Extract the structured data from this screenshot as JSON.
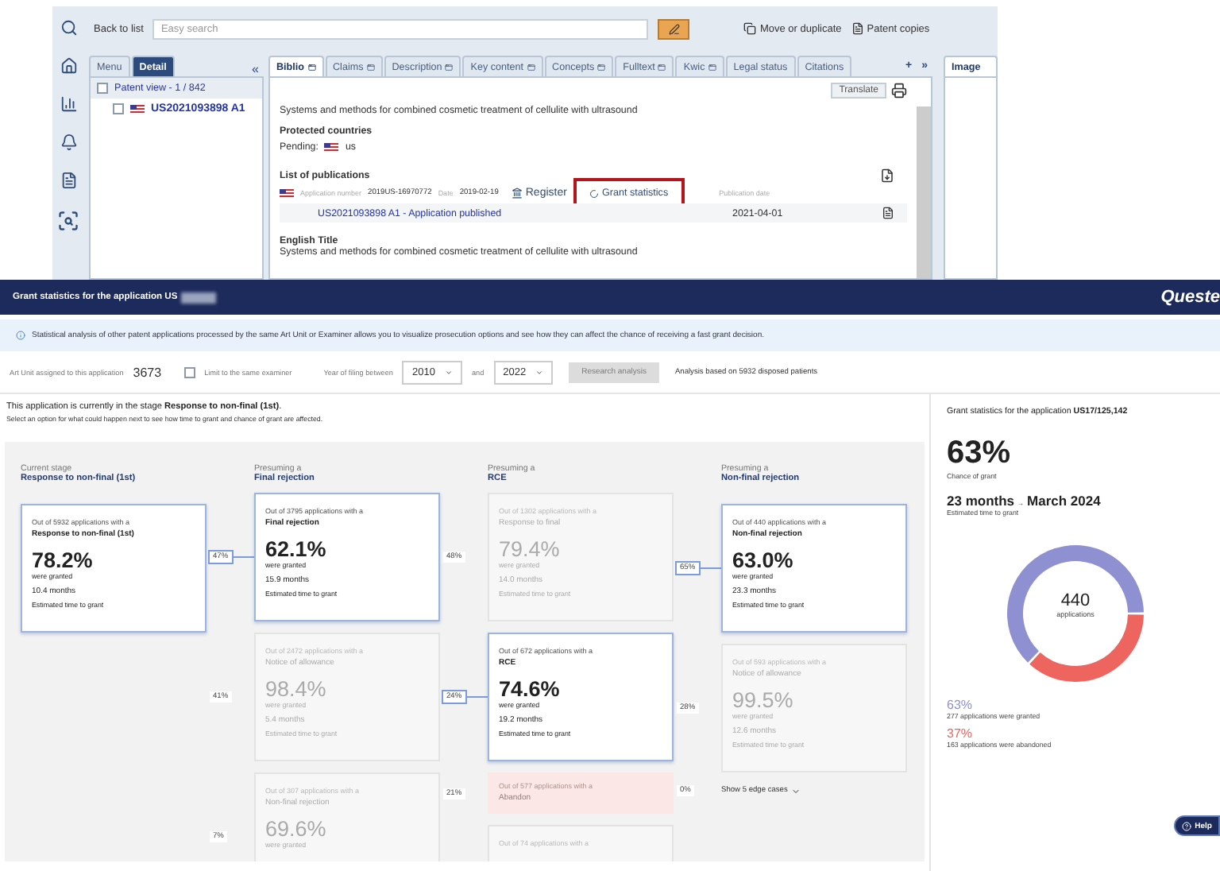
{
  "app": {
    "toolbar": {
      "back": "Back to list",
      "search_placeholder": "Easy search",
      "actions": [
        "Move or duplicate",
        "Patent copies"
      ]
    },
    "left_panel": {
      "tabs": [
        {
          "label": "Menu",
          "selected": false
        },
        {
          "label": "Detail",
          "selected": true
        }
      ],
      "collapse": "«",
      "tree": [
        {
          "label": "Patent view - 1 / 842",
          "checked": false,
          "children": [
            {
              "label": "US2021093898 A1",
              "checked": false
            }
          ]
        }
      ]
    },
    "tabs": [
      {
        "label": "Biblio",
        "selected": true
      },
      {
        "label": "Claims",
        "selected": false
      },
      {
        "label": "Description",
        "selected": false
      },
      {
        "label": "Key content",
        "selected": false
      },
      {
        "label": "Concepts",
        "selected": false
      },
      {
        "label": "Fulltext",
        "selected": false
      },
      {
        "label": "Kwic",
        "selected": false
      },
      {
        "label": "Legal status",
        "selected": false
      },
      {
        "label": "Citations",
        "selected": false
      }
    ],
    "tab_controls": [
      "+",
      "»"
    ],
    "image_tab": "Image",
    "content": {
      "translate": "Translate",
      "title": "Systems and methods for combined cosmetic treatment of cellulite with ultrasound",
      "protected_heading": "Protected countries",
      "pending_label": "Pending:",
      "pending_country": "us",
      "publications_heading": "List of publications",
      "application_label": "Application number",
      "application_number": "2019US-16970772",
      "date_label": "Date",
      "date": "2019-02-19",
      "register": "Register",
      "grant_statistics": {
        "label": "Grant statistics",
        "highlighted": true
      },
      "publication_date_label": "Publication date",
      "publication": "US2021093898  A1 - Application published",
      "publication_date": "2021-04-01",
      "english_title_heading": "English Title",
      "english_title": "Systems and methods for combined cosmetic treatment of cellulite with ultrasound"
    }
  },
  "grant_panel": {
    "header": {
      "title": "Grant statistics for the application US",
      "logo": "Queste"
    },
    "info": "Statistical analysis of other patent applications processed by the same Art Unit or Examiner allows you to visualize prosecution options and see how they can affect the chance of receiving a fast grant decision.",
    "filters": {
      "art_unit_label": "Art Unit assigned to this application",
      "art_unit": "3673",
      "same_examiner": {
        "label": "Limit to the same examiner",
        "checked": false
      },
      "year_label": "Year of filing between",
      "year_from": "2010",
      "and": "and",
      "year_to": "2022",
      "button": {
        "label": "Research analysis",
        "disabled": true
      },
      "analysis_note": "Analysis based on 5932 disposed patients"
    },
    "stage_text": "This application is currently in the stage **Response to non-final (1st)**.",
    "hint": "Select an option for what could happen next to see how time to grant and chance of grant are affected.",
    "columns": [
      {
        "heading": "Current stage",
        "stage": "Response to non-final (1st)",
        "items": [
          {
            "kind": "card",
            "selected": true,
            "count": "Out of 5932 applications with a",
            "stage": "Response to non-final (1st)",
            "percent": "78.2%",
            "granted": "were granted",
            "months": "10.4 months",
            "time_label": "Estimated time to grant"
          }
        ]
      },
      {
        "heading": "Presuming a",
        "stage": "Final rejection",
        "items": [
          {
            "kind": "card",
            "selected": true,
            "share": "47%",
            "count": "Out of 3795 applications with a",
            "stage": "Final rejection",
            "percent": "62.1%",
            "granted": "were granted",
            "months": "15.9 months",
            "time_label": "Estimated time to grant"
          },
          {
            "kind": "card",
            "selected": false,
            "share": "41%",
            "count": "Out of 2472 applications with a",
            "stage": "Notice of allowance",
            "percent": "98.4%",
            "granted": "were granted",
            "months": "5.4 months",
            "time_label": "Estimated time to grant"
          },
          {
            "kind": "card",
            "selected": false,
            "share": "7%",
            "count": "Out of 307 applications with a",
            "stage": "Non-final rejection",
            "percent": "69.6%",
            "granted": "were granted"
          }
        ]
      },
      {
        "heading": "Presuming a",
        "stage": "RCE",
        "items": [
          {
            "kind": "card",
            "selected": false,
            "share": "48%",
            "count": "Out of 1302 applications with a",
            "stage": "Response to final",
            "percent": "79.4%",
            "granted": "were granted",
            "months": "14.0 months",
            "time_label": "Estimated time to grant"
          },
          {
            "kind": "card",
            "selected": true,
            "share": "24%",
            "count": "Out of 672 applications with a",
            "stage": "RCE",
            "percent": "74.6%",
            "granted": "were granted",
            "months": "19.2 months",
            "time_label": "Estimated time to grant"
          },
          {
            "kind": "abandon",
            "selected": false,
            "share": "21%",
            "count": "Out of 577 applications with a",
            "stage": "Abandon"
          },
          {
            "kind": "card",
            "selected": false,
            "count": "Out of 74 applications with a"
          }
        ]
      },
      {
        "heading": "Presuming a",
        "stage": "Non-final rejection",
        "items": [
          {
            "kind": "card",
            "selected": true,
            "share": "65%",
            "count": "Out of 440 applications with a",
            "stage": "Non-final rejection",
            "percent": "63.0%",
            "granted": "were granted",
            "months": "23.3 months",
            "time_label": "Estimated time to grant"
          },
          {
            "kind": "card",
            "selected": false,
            "share": "28%",
            "count": "Out of 593 applications with a",
            "stage": "Notice of allowance",
            "percent": "99.5%",
            "granted": "were granted",
            "months": "12.6 months",
            "time_label": "Estimated time to grant"
          },
          {
            "kind": "edge",
            "selected": false,
            "share": "0%",
            "label": "Show 5 edge cases"
          }
        ]
      }
    ],
    "summary": {
      "title": "Grant statistics for the application **US17/125,142**",
      "chance": "63%",
      "chance_label": "Chance of grant",
      "months": "23 months",
      "arrow": "→",
      "date": "March 2024",
      "time_label": "Estimated time to grant",
      "chart_data": {
        "type": "donut",
        "series": [
          {
            "values": [
              63,
              37
            ]
          }
        ]
      },
      "total": "440",
      "total_label": "applications",
      "legend": [
        {
          "percent": "63%",
          "text": "277 applications were granted",
          "color": "#8f90d2"
        },
        {
          "percent": "37%",
          "text": "163 applications were abandoned",
          "color": "#ee6560"
        }
      ]
    },
    "help": "Help"
  }
}
